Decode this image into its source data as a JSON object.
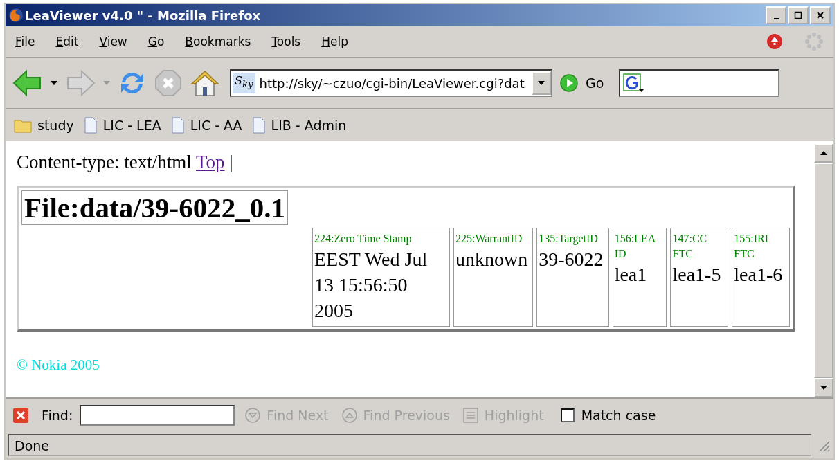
{
  "window": {
    "title": "LeaViewer v4.0 \" - Mozilla Firefox"
  },
  "menu": [
    "File",
    "Edit",
    "View",
    "Go",
    "Bookmarks",
    "Tools",
    "Help"
  ],
  "toolbar": {
    "site_icon": "S$_{ky}$",
    "address": "http://sky/~czuo/cgi-bin/LeaViewer.cgi?dat",
    "go": "Go"
  },
  "bookmarks": [
    {
      "label": "study",
      "kind": "folder"
    },
    {
      "label": "LIC - LEA",
      "kind": "page"
    },
    {
      "label": "LIC - AA",
      "kind": "page"
    },
    {
      "label": "LIB - Admin",
      "kind": "page"
    }
  ],
  "page": {
    "header_text": "Content-type: text/html",
    "header_link": "Top",
    "separator": "|",
    "file_title": "File:data/39-6022_0.1",
    "fields": [
      {
        "label": "224:Zero Time Stamp",
        "value": "EEST Wed Jul 13 15:56:50 2005"
      },
      {
        "label": "225:WarrantID",
        "value": "unknown"
      },
      {
        "label": "135:TargetID",
        "value": "39-6022"
      },
      {
        "label": "156:LEA ID",
        "value": "lea1"
      },
      {
        "label": "147:CC FTC",
        "value": "lea1-5"
      },
      {
        "label": "155:IRI FTC",
        "value": "lea1-6"
      }
    ],
    "footer": "© Nokia 2005"
  },
  "find_bar": {
    "label": "Find:",
    "buttons": [
      {
        "label": "Find Next",
        "kind": "down",
        "disabled": true
      },
      {
        "label": "Find Previous",
        "kind": "up",
        "disabled": true
      },
      {
        "label": "Highlight",
        "kind": "list",
        "disabled": true
      }
    ],
    "match_case": {
      "label": "Match case",
      "checked": false
    }
  },
  "status_bar": {
    "text": "Done"
  }
}
